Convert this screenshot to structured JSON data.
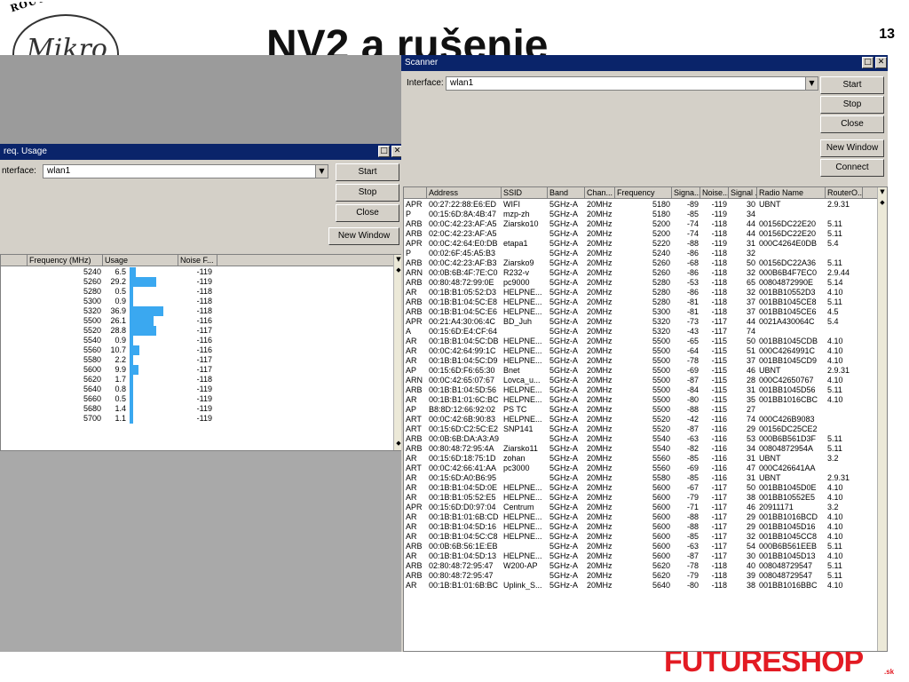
{
  "slide": {
    "logo_arc_text": "ROUTING THE WORLD",
    "logo_brand": "Mikro",
    "title": "NV2 a rušenie",
    "number": "13",
    "brand_text": "FUTURESHOP",
    "brand_tld": ".sk",
    "colors": {
      "brand": "#e31b23",
      "titlebar": "#0a246a",
      "window": "#d4d0c8",
      "usage_bar": "#3aa8f0"
    }
  },
  "freq_window": {
    "title": "req. Usage",
    "interface_label": "nterface:",
    "interface_value": "wlan1",
    "buttons": {
      "start": "Start",
      "stop": "Stop",
      "close": "Close",
      "new_window": "New Window"
    },
    "columns": [
      "Frequency (MHz)",
      "Usage",
      "Noise F..."
    ],
    "rows": [
      {
        "freq": "5240",
        "usage": "6.5",
        "noise": "-119"
      },
      {
        "freq": "5260",
        "usage": "29.2",
        "noise": "-119"
      },
      {
        "freq": "5280",
        "usage": "0.5",
        "noise": "-118"
      },
      {
        "freq": "5300",
        "usage": "0.9",
        "noise": "-118"
      },
      {
        "freq": "5320",
        "usage": "36.9",
        "noise": "-118"
      },
      {
        "freq": "5500",
        "usage": "26.1",
        "noise": "-116"
      },
      {
        "freq": "5520",
        "usage": "28.8",
        "noise": "-117"
      },
      {
        "freq": "5540",
        "usage": "0.9",
        "noise": "-116"
      },
      {
        "freq": "5560",
        "usage": "10.7",
        "noise": "-116"
      },
      {
        "freq": "5580",
        "usage": "2.2",
        "noise": "-117"
      },
      {
        "freq": "5600",
        "usage": "9.9",
        "noise": "-117"
      },
      {
        "freq": "5620",
        "usage": "1.7",
        "noise": "-118"
      },
      {
        "freq": "5640",
        "usage": "0.8",
        "noise": "-119"
      },
      {
        "freq": "5660",
        "usage": "0.5",
        "noise": "-119"
      },
      {
        "freq": "5680",
        "usage": "1.4",
        "noise": "-119"
      },
      {
        "freq": "5700",
        "usage": "1.1",
        "noise": "-119"
      }
    ]
  },
  "scanner": {
    "title": "Scanner",
    "interface_label": "Interface:",
    "interface_value": "wlan1",
    "buttons": {
      "start": "Start",
      "stop": "Stop",
      "close": "Close",
      "new_window": "New Window",
      "connect": "Connect"
    },
    "columns": [
      "Address",
      "SSID",
      "Band",
      "Chan...",
      "Frequency",
      "Signa...",
      "Noise...",
      "Signal ...",
      "Radio Name",
      "RouterO..."
    ],
    "rows": [
      [
        "APR",
        "00:27:22:88:E6:ED",
        "WIFI",
        "5GHz-A",
        "20MHz",
        "5180",
        "-89",
        "-119",
        "30",
        "UBNT",
        "2.9.31"
      ],
      [
        "P",
        "00:15:6D:8A:4B:47",
        "mzp-zh",
        "5GHz-A",
        "20MHz",
        "5180",
        "-85",
        "-119",
        "34",
        "",
        ""
      ],
      [
        "ARB",
        "00:0C:42:23:AF:A5",
        "Ziarsko10",
        "5GHz-A",
        "20MHz",
        "5200",
        "-74",
        "-118",
        "44",
        "00156DC22E20",
        "5.11"
      ],
      [
        "ARB",
        "02:0C:42:23:AF:A5",
        "",
        "5GHz-A",
        "20MHz",
        "5200",
        "-74",
        "-118",
        "44",
        "00156DC22E20",
        "5.11"
      ],
      [
        "APR",
        "00:0C:42:64:E0:DB",
        "etapa1",
        "5GHz-A",
        "20MHz",
        "5220",
        "-88",
        "-119",
        "31",
        "000C4264E0DB",
        "5.4"
      ],
      [
        "P",
        "00:02:6F:45:A5:B3",
        "",
        "5GHz-A",
        "20MHz",
        "5240",
        "-86",
        "-118",
        "32",
        "",
        ""
      ],
      [
        "ARB",
        "00:0C:42:23:AF:B3",
        "Ziarsko9",
        "5GHz-A",
        "20MHz",
        "5260",
        "-68",
        "-118",
        "50",
        "00156DC22A36",
        "5.11"
      ],
      [
        "ARN",
        "00:0B:6B:4F:7E:C0",
        "R232-v",
        "5GHz-A",
        "20MHz",
        "5260",
        "-86",
        "-118",
        "32",
        "000B6B4F7EC0",
        "2.9.44"
      ],
      [
        "ARB",
        "00:80:48:72:99:0E",
        "pc9000",
        "5GHz-A",
        "20MHz",
        "5280",
        "-53",
        "-118",
        "65",
        "00804872990E",
        "5.14"
      ],
      [
        "AR",
        "00:1B:B1:05:52:D3",
        "HELPNE...",
        "5GHz-A",
        "20MHz",
        "5280",
        "-86",
        "-118",
        "32",
        "001BB10552D3",
        "4.10"
      ],
      [
        "ARB",
        "00:1B:B1:04:5C:E8",
        "HELPNE...",
        "5GHz-A",
        "20MHz",
        "5280",
        "-81",
        "-118",
        "37",
        "001BB1045CE8",
        "5.11"
      ],
      [
        "ARB",
        "00:1B:B1:04:5C:E6",
        "HELPNE...",
        "5GHz-A",
        "20MHz",
        "5300",
        "-81",
        "-118",
        "37",
        "001BB1045CE6",
        "4.5"
      ],
      [
        "APR",
        "00:21:A4:30:06:4C",
        "BD_Juh",
        "5GHz-A",
        "20MHz",
        "5320",
        "-73",
        "-117",
        "44",
        "0021A430064C",
        "5.4"
      ],
      [
        "A",
        "00:15:6D:E4:CF:64",
        "",
        "5GHz-A",
        "20MHz",
        "5320",
        "-43",
        "-117",
        "74",
        "",
        ""
      ],
      [
        "AR",
        "00:1B:B1:04:5C:DB",
        "HELPNE...",
        "5GHz-A",
        "20MHz",
        "5500",
        "-65",
        "-115",
        "50",
        "001BB1045CDB",
        "4.10"
      ],
      [
        "AR",
        "00:0C:42:64:99:1C",
        "HELPNE...",
        "5GHz-A",
        "20MHz",
        "5500",
        "-64",
        "-115",
        "51",
        "000C4264991C",
        "4.10"
      ],
      [
        "AR",
        "00:1B:B1:04:5C:D9",
        "HELPNE...",
        "5GHz-A",
        "20MHz",
        "5500",
        "-78",
        "-115",
        "37",
        "001BB1045CD9",
        "4.10"
      ],
      [
        "AP",
        "00:15:6D:F6:65:30",
        "Bnet",
        "5GHz-A",
        "20MHz",
        "5500",
        "-69",
        "-115",
        "46",
        "UBNT",
        "2.9.31"
      ],
      [
        "ARN",
        "00:0C:42:65:07:67",
        "Lovca_u...",
        "5GHz-A",
        "20MHz",
        "5500",
        "-87",
        "-115",
        "28",
        "000C42650767",
        "4.10"
      ],
      [
        "ARB",
        "00:1B:B1:04:5D:56",
        "HELPNE...",
        "5GHz-A",
        "20MHz",
        "5500",
        "-84",
        "-115",
        "31",
        "001BB1045D56",
        "5.11"
      ],
      [
        "AR",
        "00:1B:B1:01:6C:BC",
        "HELPNE...",
        "5GHz-A",
        "20MHz",
        "5500",
        "-80",
        "-115",
        "35",
        "001BB1016CBC",
        "4.10"
      ],
      [
        "AP",
        "B8:8D:12:66:92:02",
        "PS TC",
        "5GHz-A",
        "20MHz",
        "5500",
        "-88",
        "-115",
        "27",
        "",
        ""
      ],
      [
        "ART",
        "00:0C:42:6B:90:83",
        "HELPNE...",
        "5GHz-A",
        "20MHz",
        "5520",
        "-42",
        "-116",
        "74",
        "000C426B9083",
        ""
      ],
      [
        "ART",
        "00:15:6D:C2:5C:E2",
        "SNP141",
        "5GHz-A",
        "20MHz",
        "5520",
        "-87",
        "-116",
        "29",
        "00156DC25CE2",
        ""
      ],
      [
        "ARB",
        "00:0B:6B:DA:A3:A9",
        "",
        "5GHz-A",
        "20MHz",
        "5540",
        "-63",
        "-116",
        "53",
        "000B6B561D3F",
        "5.11"
      ],
      [
        "ARB",
        "00:80:48:72:95:4A",
        "Ziarsko11",
        "5GHz-A",
        "20MHz",
        "5540",
        "-82",
        "-116",
        "34",
        "00804872954A",
        "5.11"
      ],
      [
        "AR",
        "00:15:6D:18:75:1D",
        "zohan",
        "5GHz-A",
        "20MHz",
        "5560",
        "-85",
        "-116",
        "31",
        "UBNT",
        "3.2"
      ],
      [
        "ART",
        "00:0C:42:66:41:AA",
        "pc3000",
        "5GHz-A",
        "20MHz",
        "5560",
        "-69",
        "-116",
        "47",
        "000C426641AA",
        ""
      ],
      [
        "AR",
        "00:15:6D:A0:B6:95",
        "",
        "5GHz-A",
        "20MHz",
        "5580",
        "-85",
        "-116",
        "31",
        "UBNT",
        "2.9.31"
      ],
      [
        "AR",
        "00:1B:B1:04:5D:0E",
        "HELPNE...",
        "5GHz-A",
        "20MHz",
        "5600",
        "-67",
        "-117",
        "50",
        "001BB1045D0E",
        "4.10"
      ],
      [
        "AR",
        "00:1B:B1:05:52:E5",
        "HELPNE...",
        "5GHz-A",
        "20MHz",
        "5600",
        "-79",
        "-117",
        "38",
        "001BB10552E5",
        "4.10"
      ],
      [
        "APR",
        "00:15:6D:D0:97:04",
        "Centrum",
        "5GHz-A",
        "20MHz",
        "5600",
        "-71",
        "-117",
        "46",
        "20911171",
        "3.2"
      ],
      [
        "AR",
        "00:1B:B1:01:6B:CD",
        "HELPNE...",
        "5GHz-A",
        "20MHz",
        "5600",
        "-88",
        "-117",
        "29",
        "001BB1016BCD",
        "4.10"
      ],
      [
        "AR",
        "00:1B:B1:04:5D:16",
        "HELPNE...",
        "5GHz-A",
        "20MHz",
        "5600",
        "-88",
        "-117",
        "29",
        "001BB1045D16",
        "4.10"
      ],
      [
        "AR",
        "00:1B:B1:04:5C:C8",
        "HELPNE...",
        "5GHz-A",
        "20MHz",
        "5600",
        "-85",
        "-117",
        "32",
        "001BB1045CC8",
        "4.10"
      ],
      [
        "ARB",
        "00:0B:6B:56:1E:EB",
        "",
        "5GHz-A",
        "20MHz",
        "5600",
        "-63",
        "-117",
        "54",
        "000B6B561EEB",
        "5.11"
      ],
      [
        "AR",
        "00:1B:B1:04:5D:13",
        "HELPNE...",
        "5GHz-A",
        "20MHz",
        "5600",
        "-87",
        "-117",
        "30",
        "001BB1045D13",
        "4.10"
      ],
      [
        "ARB",
        "02:80:48:72:95:47",
        "W200-AP",
        "5GHz-A",
        "20MHz",
        "5620",
        "-78",
        "-118",
        "40",
        "008048729547",
        "5.11"
      ],
      [
        "ARB",
        "00:80:48:72:95:47",
        "",
        "5GHz-A",
        "20MHz",
        "5620",
        "-79",
        "-118",
        "39",
        "008048729547",
        "5.11"
      ],
      [
        "AR",
        "00:1B:B1:01:6B:BC",
        "Uplink_S...",
        "5GHz-A",
        "20MHz",
        "5640",
        "-80",
        "-118",
        "38",
        "001BB1016BBC",
        "4.10"
      ]
    ]
  }
}
